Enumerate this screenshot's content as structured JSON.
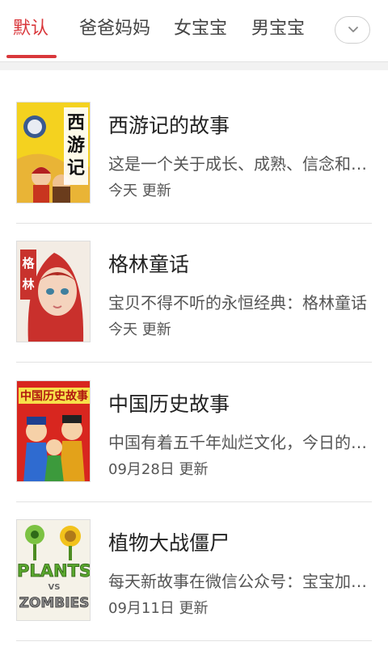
{
  "tabs": [
    {
      "label": "默认",
      "active": true
    },
    {
      "label": "爸爸妈妈",
      "active": false
    },
    {
      "label": "女宝宝",
      "active": false
    },
    {
      "label": "男宝宝",
      "active": false
    }
  ],
  "more_icon": "chevron-down-icon",
  "accent_color": "#d9373b",
  "stories": [
    {
      "title": "西游记的故事",
      "description": "这是一个关于成长、成熟、信念和…",
      "date": "今天",
      "update_suffix": "更新",
      "cover_text": "西游记"
    },
    {
      "title": "格林童话",
      "description": "宝贝不得不听的永恒经典：格林童话",
      "date": "今天",
      "update_suffix": "更新",
      "cover_text": "格林童话"
    },
    {
      "title": "中国历史故事",
      "description": "中国有着五千年灿烂文化，今日的…",
      "date": "09月28日",
      "update_suffix": "更新",
      "cover_text": "中国历史故事"
    },
    {
      "title": "植物大战僵尸",
      "description": "每天新故事在微信公众号：宝宝加…",
      "date": "09月11日",
      "update_suffix": "更新",
      "cover_text": "PLANTS VS ZOMBIES"
    }
  ]
}
